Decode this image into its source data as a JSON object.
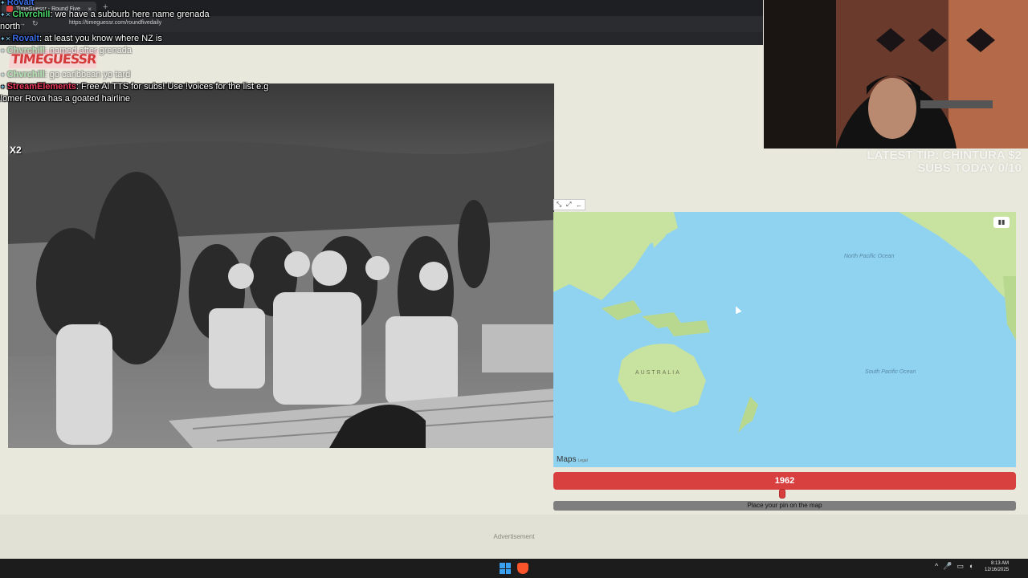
{
  "browser": {
    "tab_title": "TimeGuessr - Round Five",
    "new_tab_icon": "plus-icon",
    "url": "https://timeguessr.com/roundfivedaily"
  },
  "site": {
    "logo_text": "TIMEGUESSR",
    "year_value": "1962",
    "pin_prompt": "Place your pin on the map",
    "advertisement_label": "Advertisement"
  },
  "map": {
    "labels": {
      "north_pacific": "North Pacific Ocean",
      "south_pacific": "South Pacific Ocean",
      "australia": "AUSTRALIA"
    },
    "brand": "Maps",
    "legal": "Legal",
    "colors": {
      "water": "#8fd3f0",
      "land": "#c8e2a0"
    }
  },
  "overlays": {
    "latest_tip": "LATEST TIP: CHINTURA $2",
    "subs_today": "SUBS TODAY 0/10",
    "multiplier": "X2"
  },
  "chat": [
    {
      "user": "Rovalt",
      "text": "",
      "color": "blue",
      "faded": false
    },
    {
      "user": "Chvrchill",
      "text": ": we have a subburb here name grenada",
      "color": "green",
      "faded": false
    },
    {
      "user": "",
      "text": "north",
      "color": "",
      "faded": false
    },
    {
      "user": "Rovalt",
      "text": ": at least you know where NZ is",
      "color": "blue",
      "faded": false
    },
    {
      "user": "Chvrchill",
      "text": ": named after grenada",
      "color": "green",
      "faded": true
    },
    {
      "user": "Chvrchill",
      "text": ": go caribbean yo tard",
      "color": "green",
      "faded": true
    },
    {
      "user": "StreamElements",
      "text": ": Free AI TTS for subs! Use !voices for the list e.g",
      "color": "red",
      "faded": false
    },
    {
      "user": "",
      "text": "!omer Rova has a goated hairline",
      "color": "",
      "faded": false
    }
  ],
  "taskbar": {
    "time": "8:13 AM",
    "date": "12/16/2025"
  }
}
